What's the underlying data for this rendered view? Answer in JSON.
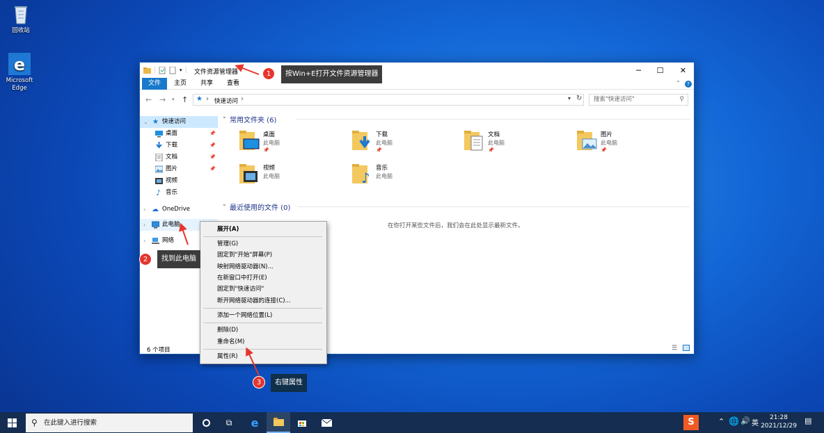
{
  "desktop": {
    "icons": [
      {
        "label": "回收站",
        "icon": "recycle-bin-icon"
      },
      {
        "label": "Microsoft Edge",
        "icon": "edge-icon"
      }
    ]
  },
  "window": {
    "title": "文件资源管理器",
    "controls": {
      "minimize": "─",
      "maximize": "☐",
      "close": "✕"
    },
    "ribbon_tabs": [
      "文件",
      "主页",
      "共享",
      "查看"
    ],
    "address": {
      "path": "快速访问",
      "sep": "›"
    },
    "search_placeholder": "搜索\"快速访问\"",
    "nav": {
      "quick_access": "快速访问",
      "quick_items": [
        {
          "label": "桌面",
          "pinned": true
        },
        {
          "label": "下载",
          "pinned": true
        },
        {
          "label": "文档",
          "pinned": true
        },
        {
          "label": "图片",
          "pinned": true
        },
        {
          "label": "视频",
          "pinned": false
        },
        {
          "label": "音乐",
          "pinned": false
        }
      ],
      "onedrive": "OneDrive",
      "this_pc": "此电脑",
      "network": "网络"
    },
    "content": {
      "frequent_header": "常用文件夹 (6)",
      "folders": [
        {
          "name": "桌面",
          "sub": "此电脑",
          "pinned": true
        },
        {
          "name": "下载",
          "sub": "此电脑",
          "pinned": true
        },
        {
          "name": "文档",
          "sub": "此电脑",
          "pinned": true
        },
        {
          "name": "图片",
          "sub": "此电脑",
          "pinned": true
        },
        {
          "name": "视频",
          "sub": "此电脑",
          "pinned": false
        },
        {
          "name": "音乐",
          "sub": "此电脑",
          "pinned": false
        }
      ],
      "recent_header": "最近使用的文件 (0)",
      "recent_empty": "在你打开某些文件后，我们会在此处显示最新文件。"
    },
    "status": "6 个项目"
  },
  "context_menu": {
    "items": [
      "展开(A)",
      "管理(G)",
      "固定到\"开始\"屏幕(P)",
      "映射网络驱动器(N)...",
      "在新窗口中打开(E)",
      "固定到\"快速访问\"",
      "断开网络驱动器的连接(C)...",
      "添加一个网络位置(L)",
      "删除(D)",
      "重命名(M)",
      "属性(R)"
    ]
  },
  "annotations": [
    {
      "num": "1",
      "text": "按Win+E打开文件资源管理器"
    },
    {
      "num": "2",
      "text": "找到此电脑"
    },
    {
      "num": "3",
      "text": "右键属性"
    }
  ],
  "taskbar": {
    "search_placeholder": "在此键入进行搜索",
    "clock_time": "21:28",
    "clock_date": "2021/12/29",
    "ime": "英"
  },
  "colors": {
    "accent": "#1979ca",
    "badge": "#e5352c",
    "tooltip": "#3c3c3c",
    "tooltip_dark": "#0f2f4a"
  }
}
